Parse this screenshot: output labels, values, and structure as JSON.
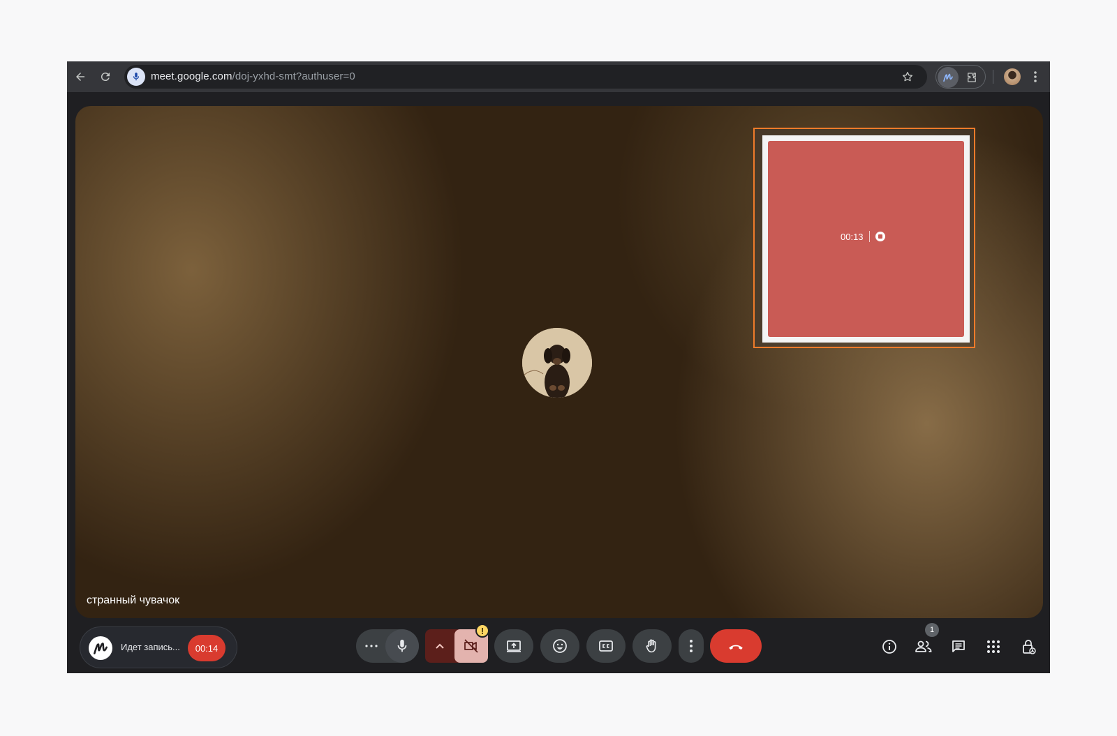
{
  "browser": {
    "url_host": "meet.google.com",
    "url_path": "/doj-yxhd-smt?authuser=0",
    "icons": [
      "back-arrow-icon",
      "reload-icon",
      "microphone-icon",
      "star-icon",
      "extension-m-icon",
      "puzzle-icon",
      "profile-avatar",
      "more-vert-icon"
    ]
  },
  "stage": {
    "participant_name": "странный чувачок",
    "avatar": "dog-photo-avatar"
  },
  "recorder_popup": {
    "elapsed": "00:13",
    "stop_icon": "stop-record-icon",
    "panel_color": "#c95b55",
    "outline_color": "#ef7b2a"
  },
  "controls": {
    "recording_label": "Идет запись...",
    "recording_timer": "00:14",
    "timer_color": "#d93b2f",
    "camera_warning": "!",
    "participants_count": "1",
    "left_buttons": [
      "more-horiz-icon",
      "microphone-icon",
      "chevron-up-icon",
      "camera-off-icon"
    ],
    "center_buttons": [
      "present-screen-icon",
      "emoji-icon",
      "captions-icon",
      "raise-hand-icon",
      "more-vert-icon",
      "end-call-icon"
    ],
    "right_buttons": [
      "info-icon",
      "people-icon",
      "chat-icon",
      "apps-grid-icon",
      "host-controls-icon"
    ]
  }
}
